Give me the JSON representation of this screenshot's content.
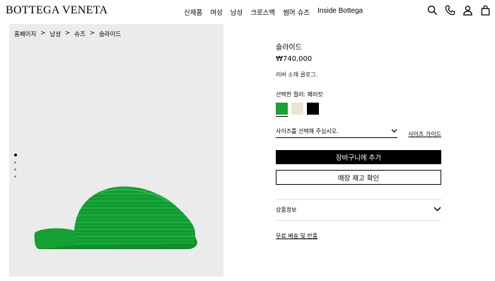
{
  "header": {
    "logo": "BOTTEGA VENETA",
    "nav": [
      "신제품",
      "여성",
      "남성",
      "크로스백",
      "썸머 슈즈",
      "Inside Bottega"
    ],
    "icons": [
      "search-icon",
      "phone-icon",
      "account-icon",
      "bag-icon"
    ]
  },
  "breadcrumb": {
    "items": [
      "홈페이지",
      "남성",
      "슈즈",
      "슬라이드"
    ],
    "separator": ">"
  },
  "gallery": {
    "image_count": 4,
    "active_index": 0,
    "product_color": "#1aaa3a"
  },
  "product": {
    "title": "슬라이드",
    "price": "₩740,000",
    "description": "러버 소재 클로그.",
    "color_label": "선택한 컬러: 패러킷",
    "swatches": [
      {
        "name": "패러킷",
        "color": "#1aa13a",
        "selected": true
      },
      {
        "name": "ivory",
        "color": "#ece5d6",
        "selected": false
      },
      {
        "name": "black",
        "color": "#000000",
        "selected": false
      }
    ],
    "size_placeholder": "사이즈를 선택해 주십시오.",
    "size_guide": "사이즈 가이드",
    "add_to_cart": "장바구니에 추가",
    "check_stock": "매장 재고 확인",
    "info_label": "상품정보",
    "shipping": "무료 배송 및 반품"
  }
}
